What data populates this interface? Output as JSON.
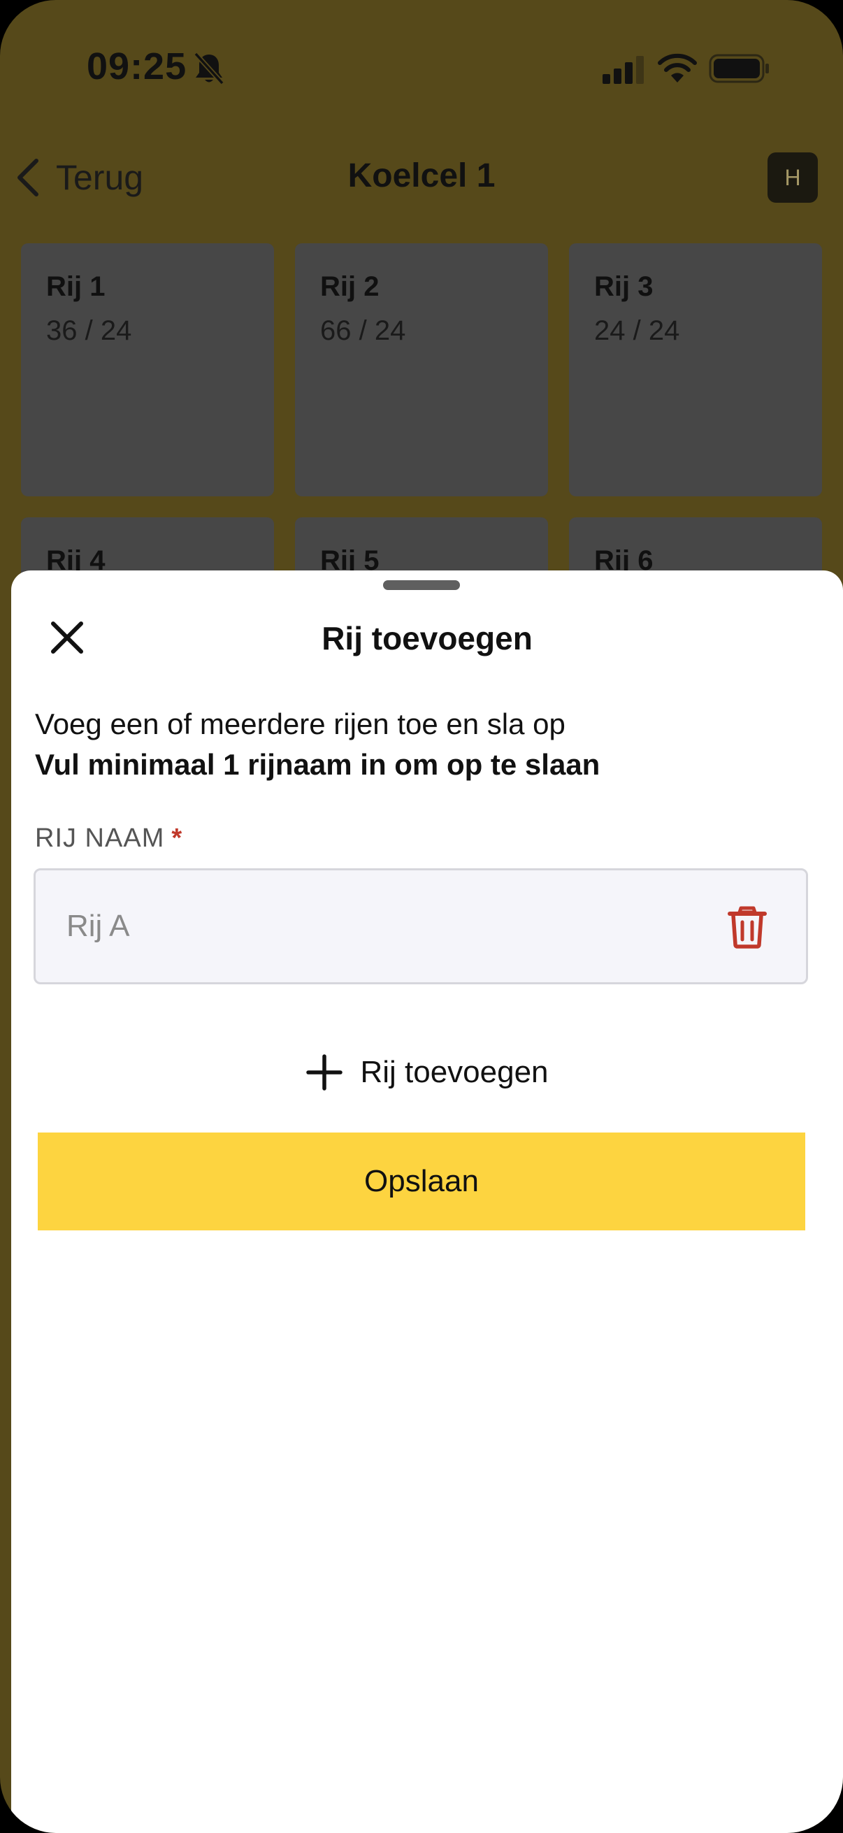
{
  "status_bar": {
    "time": "09:25",
    "icons": [
      "bell-slash-icon",
      "signal-icon",
      "wifi-icon",
      "battery-icon"
    ]
  },
  "nav": {
    "back_label": "Terug",
    "title": "Koelcel 1",
    "avatar_initial": "H"
  },
  "rows": [
    {
      "name": "Rij 1",
      "count": "36 / 24"
    },
    {
      "name": "Rij 2",
      "count": "66 / 24"
    },
    {
      "name": "Rij 3",
      "count": "24 / 24"
    },
    {
      "name": "Rij 4",
      "count": ""
    },
    {
      "name": "Rij 5",
      "count": ""
    },
    {
      "name": "Rij 6",
      "count": ""
    }
  ],
  "sheet": {
    "title": "Rij toevoegen",
    "instruction": "Voeg een of meerdere rijen toe en sla op",
    "instruction_strong": "Vul minimaal 1 rijnaam in om op te slaan",
    "field_label": "RIJ NAAM",
    "required_marker": "*",
    "input_value": "",
    "input_placeholder": "Rij A",
    "add_row_label": "Rij toevoegen",
    "save_label": "Opslaan"
  },
  "colors": {
    "accent_yellow": "#fdd440",
    "overlay_background": "#56491a",
    "tile_background": "#474747",
    "danger_red": "#c0392b",
    "input_background": "#f5f5fa"
  }
}
